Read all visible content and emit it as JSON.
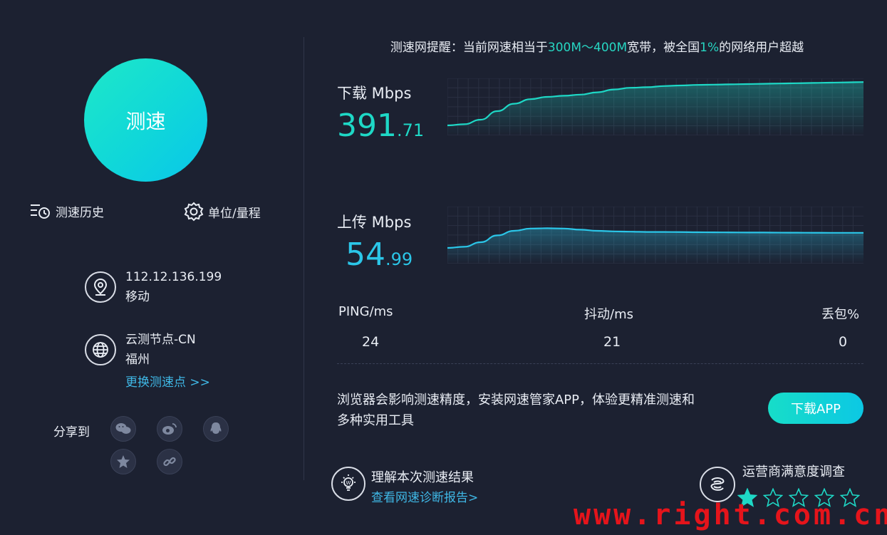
{
  "speed_button": {
    "label": "测速"
  },
  "tools": {
    "history": "测速历史",
    "unit": "单位/量程"
  },
  "client": {
    "ip": "112.12.136.199",
    "isp": "移动"
  },
  "node": {
    "name": "云测节点-CN",
    "city": "福州",
    "change_link": "更换测速点 >>"
  },
  "share": {
    "label": "分享到",
    "icons": [
      "wechat-icon",
      "weibo-icon",
      "qq-icon",
      "qzone-icon",
      "link-icon"
    ]
  },
  "notice": {
    "prefix": "测速网提醒：当前网速相当于",
    "range": "300M～400M",
    "middle": "宽带，被全国",
    "percent": "1%",
    "suffix": "的网络用户超越"
  },
  "download": {
    "label": "下载 Mbps",
    "int": "391",
    "dec": ".71",
    "progress": [
      0.2,
      0.22,
      0.3,
      0.45,
      0.58,
      0.66,
      0.7,
      0.72,
      0.74,
      0.78,
      0.83,
      0.86,
      0.87,
      0.89,
      0.9,
      0.91,
      0.915,
      0.92,
      0.925,
      0.93,
      0.935,
      0.94,
      0.945,
      0.95,
      0.955,
      0.96
    ]
  },
  "upload": {
    "label": "上传 Mbps",
    "int": "54",
    "dec": ".99",
    "progress": [
      0.3,
      0.32,
      0.4,
      0.52,
      0.6,
      0.64,
      0.645,
      0.64,
      0.62,
      0.6,
      0.59,
      0.585,
      0.58,
      0.58,
      0.578,
      0.575,
      0.573,
      0.572,
      0.57,
      0.57,
      0.568,
      0.567,
      0.566,
      0.565,
      0.565,
      0.565
    ]
  },
  "stats": [
    {
      "label": "PING/ms",
      "value": "24"
    },
    {
      "label": "抖动/ms",
      "value": "21"
    },
    {
      "label": "丢包%",
      "value": "0"
    }
  ],
  "promo": {
    "text_line1": "浏览器会影响测速精度，安装网速管家APP，体验更精准测速和",
    "text_line2": "多种实用工具",
    "button": "下载APP"
  },
  "report": {
    "title": "理解本次测速结果",
    "link": "查看网速诊断报告>"
  },
  "survey": {
    "title": "运营商满意度调查",
    "rating": 1,
    "max": 5
  },
  "watermark": "www.right.com.cn",
  "colors": {
    "background": "#1c2131",
    "accent": "#1ed8c6",
    "upload": "#2bc6e8",
    "link": "#3fb8e6",
    "watermark": "#e5141b"
  }
}
